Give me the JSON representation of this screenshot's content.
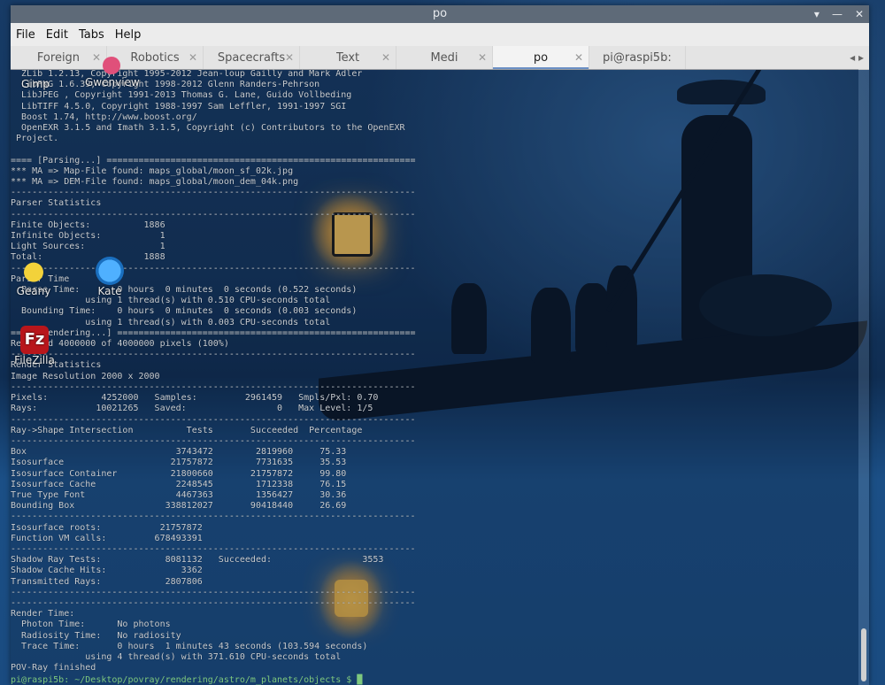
{
  "window": {
    "title": "po",
    "controls": [
      "▾",
      "—",
      "✕"
    ]
  },
  "menubar": [
    "File",
    "Edit",
    "Tabs",
    "Help"
  ],
  "tabs": [
    {
      "label": "Foreign",
      "close": "✕",
      "active": false
    },
    {
      "label": "Robotics",
      "close": "✕",
      "active": false
    },
    {
      "label": "Spacecrafts",
      "close": "✕",
      "active": false
    },
    {
      "label": "Text",
      "close": "✕",
      "active": false
    },
    {
      "label": "Medi",
      "close": "✕",
      "active": false
    },
    {
      "label": "po",
      "close": "✕",
      "active": true
    },
    {
      "label": "pi@raspi5b: …",
      "close": "",
      "active": false
    }
  ],
  "tab_scroll": "◂ ▸",
  "terminal": {
    "lines": [
      "  ZLib 1.2.13, Copyright 1995-2012 Jean-loup Gailly and Mark Adler",
      "  LibPNG 1.6.39, Copyright 1998-2012 Glenn Randers-Pehrson",
      "  LibJPEG , Copyright 1991-2013 Thomas G. Lane, Guido Vollbeding",
      "  LibTIFF 4.5.0, Copyright 1988-1997 Sam Leffler, 1991-1997 SGI",
      "  Boost 1.74, http://www.boost.org/",
      "  OpenEXR 3.1.5 and Imath 3.1.5, Copyright (c) Contributors to the OpenEXR",
      " Project.",
      "",
      "==== [Parsing...] ==========================================================",
      "*** MA => Map-File found: maps_global/moon_sf_02k.jpg",
      "*** MA => DEM-File found: maps_global/moon_dem_04k.png",
      "----------------------------------------------------------------------------",
      "Parser Statistics",
      "----------------------------------------------------------------------------",
      "Finite Objects:          1886",
      "Infinite Objects:           1",
      "Light Sources:              1",
      "Total:                   1888",
      "----------------------------------------------------------------------------",
      "Parser Time",
      "  Parse Time:       0 hours  0 minutes  0 seconds (0.522 seconds)",
      "              using 1 thread(s) with 0.510 CPU-seconds total",
      "  Bounding Time:    0 hours  0 minutes  0 seconds (0.003 seconds)",
      "              using 1 thread(s) with 0.003 CPU-seconds total",
      "==== [Rendering...] ========================================================",
      "Rendered 4000000 of 4000000 pixels (100%)",
      "----------------------------------------------------------------------------",
      "Render Statistics",
      "Image Resolution 2000 x 2000",
      "----------------------------------------------------------------------------",
      "Pixels:          4252000   Samples:         2961459   Smpls/Pxl: 0.70",
      "Rays:           10021265   Saved:                 0   Max Level: 1/5",
      "----------------------------------------------------------------------------",
      "Ray->Shape Intersection          Tests       Succeeded  Percentage",
      "----------------------------------------------------------------------------",
      "Box                            3743472        2819960     75.33",
      "Isosurface                    21757872        7731635     35.53",
      "Isosurface Container          21800660       21757872     99.80",
      "Isosurface Cache               2248545        1712338     76.15",
      "True Type Font                 4467363        1356427     30.36",
      "Bounding Box                 338812027       90418440     26.69",
      "----------------------------------------------------------------------------",
      "Isosurface roots:           21757872",
      "Function VM calls:         678493391",
      "----------------------------------------------------------------------------",
      "Shadow Ray Tests:            8081132   Succeeded:                 3553",
      "Shadow Cache Hits:              3362",
      "Transmitted Rays:            2807806",
      "----------------------------------------------------------------------------",
      "----------------------------------------------------------------------------",
      "Render Time:",
      "  Photon Time:      No photons",
      "  Radiosity Time:   No radiosity",
      "  Trace Time:       0 hours  1 minutes 43 seconds (103.594 seconds)",
      "              using 4 thread(s) with 371.610 CPU-seconds total",
      "POV-Ray finished"
    ],
    "prompt": "pi@raspi5b: ~/Desktop/povray/rendering/astro/m_planets/objects $ █"
  },
  "desktop_icons": [
    {
      "label": "Gimp",
      "icon": "gimp-icon"
    },
    {
      "label": "Gwenview",
      "icon": "gwenview-icon"
    },
    {
      "label": "Geany",
      "icon": "geany-icon"
    },
    {
      "label": "Kate",
      "icon": "kate-icon"
    },
    {
      "label": "FileZilla",
      "icon": "filezilla-icon"
    }
  ],
  "colors": {
    "terminal_text": "#c8cdd3",
    "titlebar": "#5e6a78",
    "tab_active_indicator": "#6b8fc4",
    "prompt": "#7ec87e"
  }
}
